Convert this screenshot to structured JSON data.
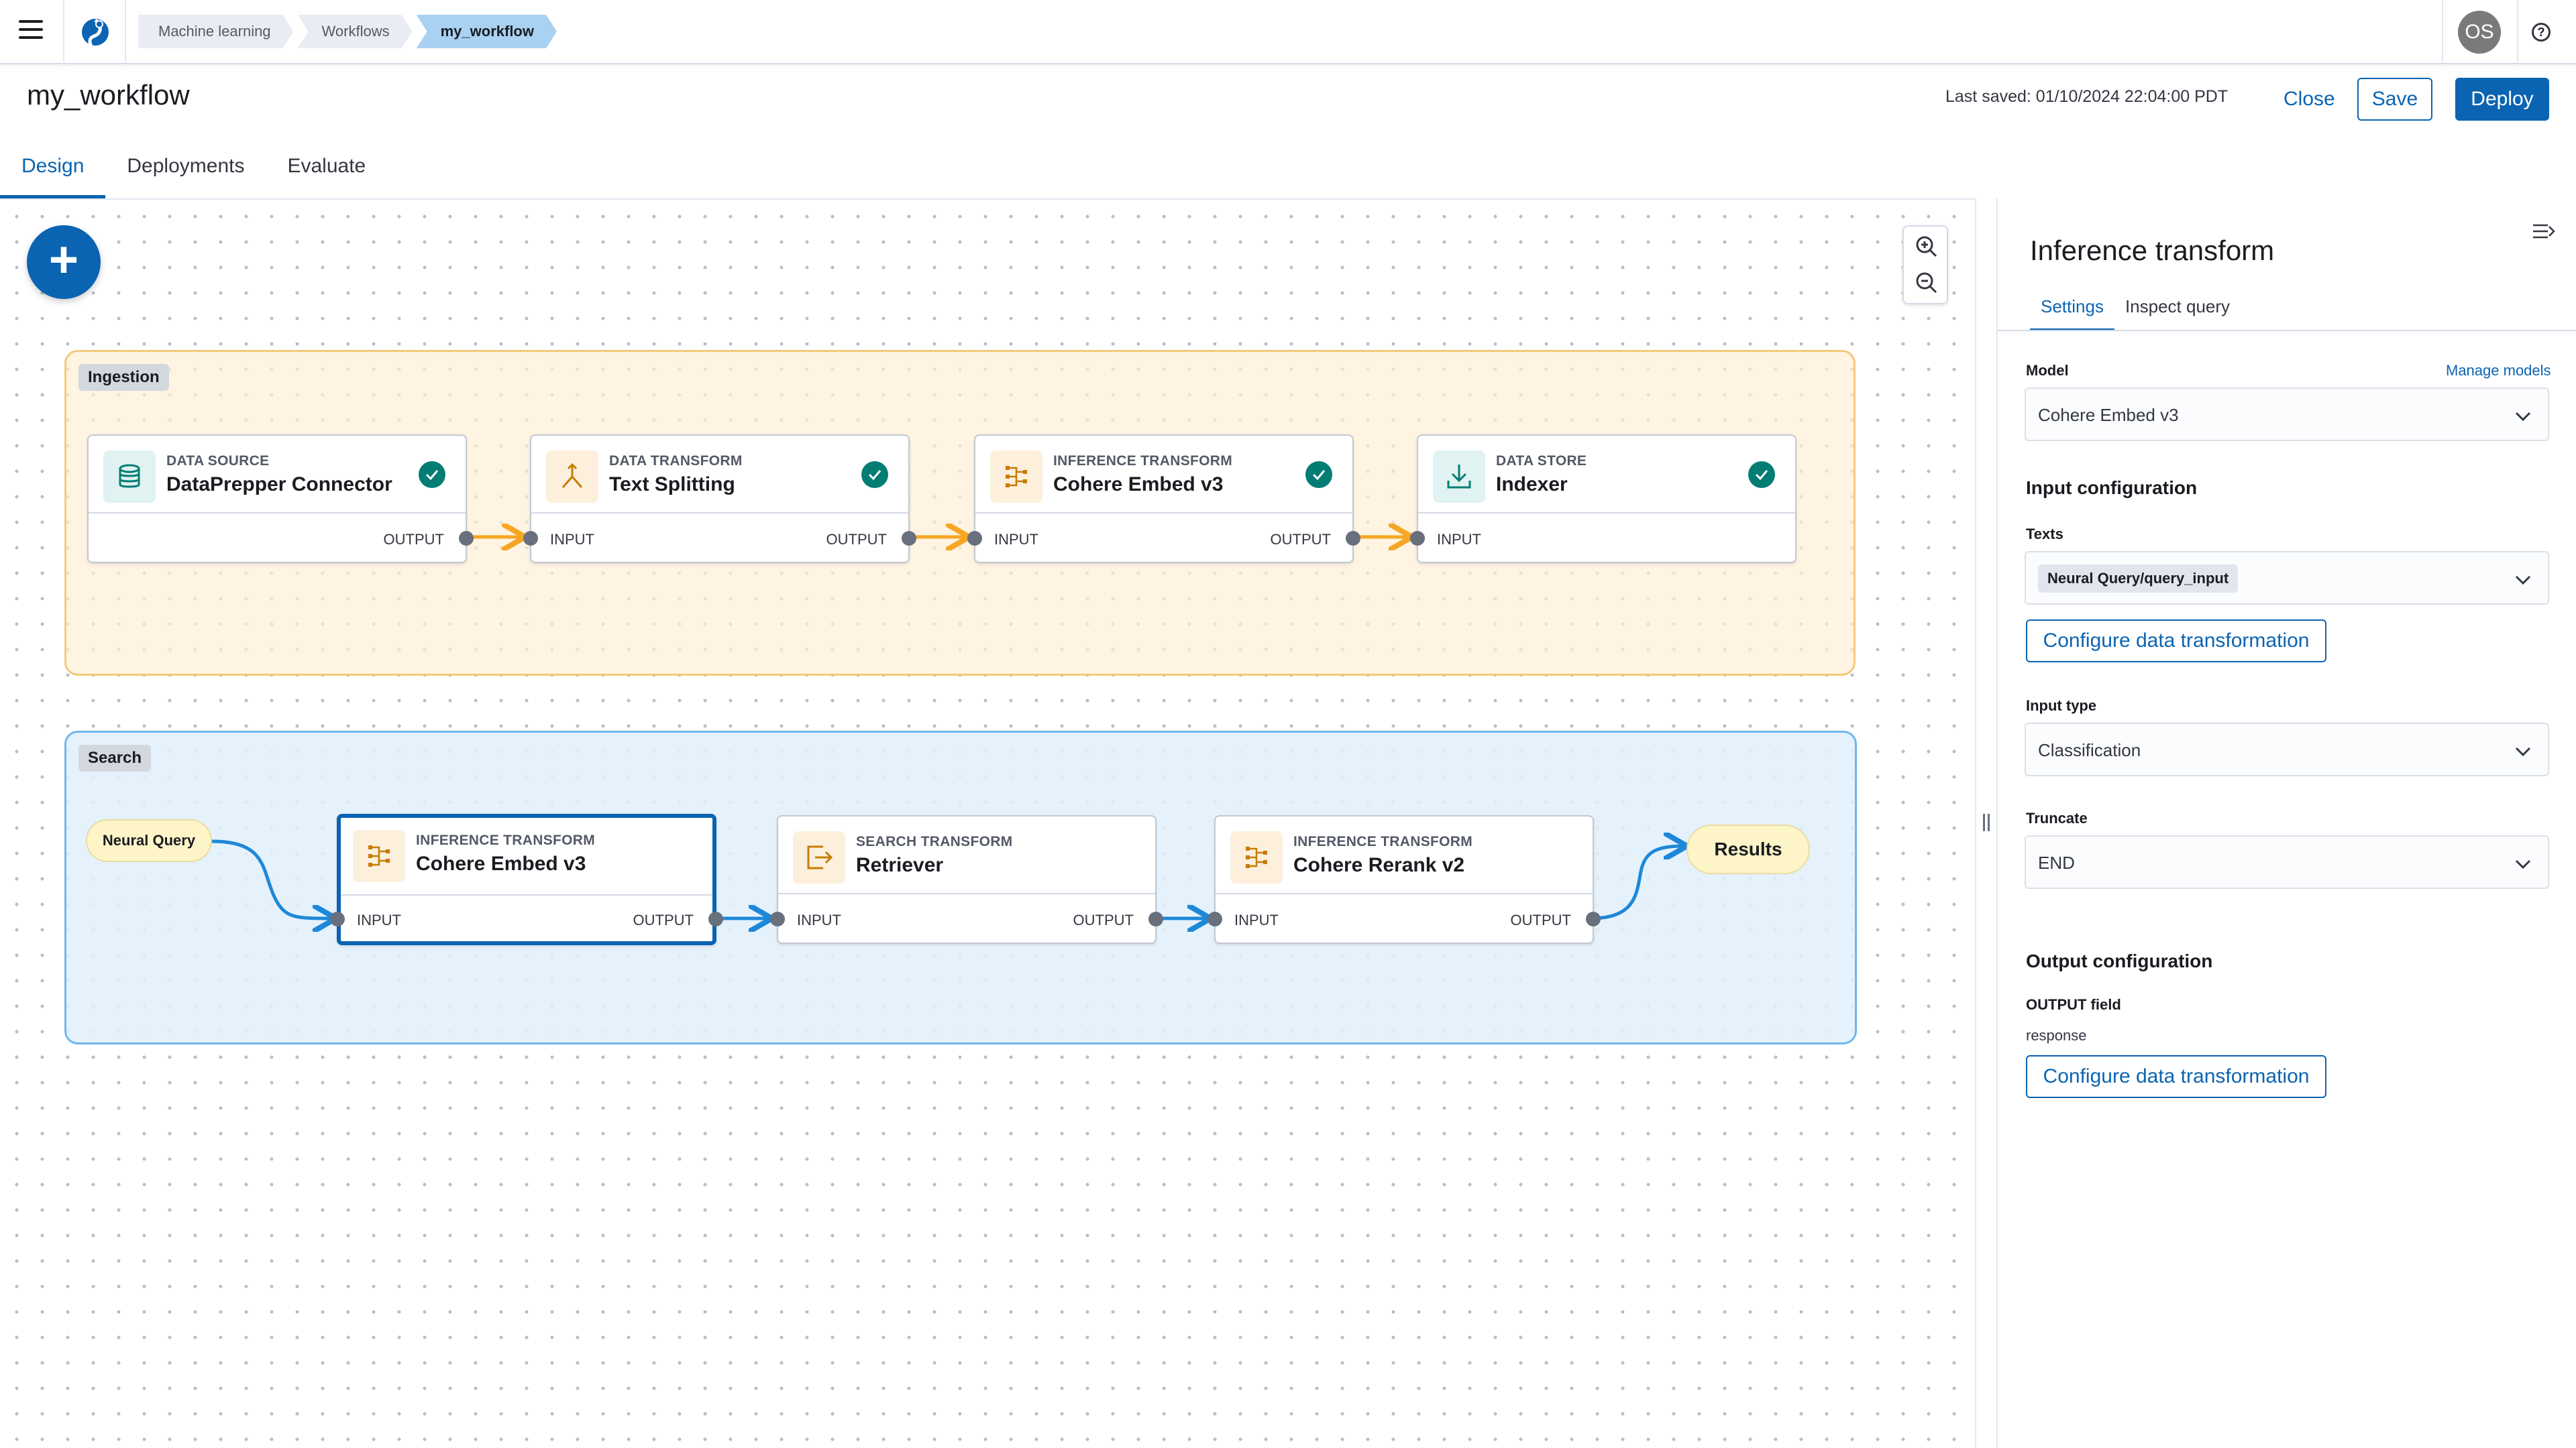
{
  "nav": {
    "breadcrumbs": [
      "Machine learning",
      "Workflows",
      "my_workflow"
    ],
    "avatar": "OS",
    "help": "?"
  },
  "header": {
    "title": "my_workflow",
    "last_saved": "Last saved: 01/10/2024 22:04:00 PDT",
    "close_label": "Close",
    "save_label": "Save",
    "deploy_label": "Deploy"
  },
  "tabs": [
    "Design",
    "Deployments",
    "Evaluate"
  ],
  "canvas": {
    "add_label": "+",
    "groups": {
      "ingestion": {
        "label": "Ingestion",
        "nodes": [
          {
            "type": "DATA SOURCE",
            "name": "DataPrepper Connector",
            "icon": "database-icon",
            "status": "complete",
            "in": "",
            "out": "OUTPUT"
          },
          {
            "type": "DATA TRANSFORM",
            "name": "Text Splitting",
            "icon": "split-icon",
            "status": "complete",
            "in": "INPUT",
            "out": "OUTPUT"
          },
          {
            "type": "INFERENCE TRANSFORM",
            "name": "Cohere Embed v3",
            "icon": "inference-icon",
            "status": "complete",
            "in": "INPUT",
            "out": "OUTPUT"
          },
          {
            "type": "DATA STORE",
            "name": "Indexer",
            "icon": "download-icon",
            "status": "complete",
            "in": "INPUT",
            "out": ""
          }
        ]
      },
      "search": {
        "label": "Search",
        "query_label": "Neural Query",
        "results_label": "Results",
        "nodes": [
          {
            "type": "INFERENCE TRANSFORM",
            "name": "Cohere Embed v3",
            "icon": "inference-icon",
            "selected": true,
            "in": "INPUT",
            "out": "OUTPUT"
          },
          {
            "type": "SEARCH TRANSFORM",
            "name": "Retriever",
            "icon": "retriever-icon",
            "in": "INPUT",
            "out": "OUTPUT"
          },
          {
            "type": "INFERENCE TRANSFORM",
            "name": "Cohere Rerank v2",
            "icon": "inference-icon",
            "in": "INPUT",
            "out": "OUTPUT"
          }
        ]
      }
    }
  },
  "panel": {
    "title": "Inference transform",
    "tabs": [
      "Settings",
      "Inspect query"
    ],
    "model_label": "Model",
    "manage_models": "Manage models",
    "model_value": "Cohere Embed v3",
    "input_config_heading": "Input configuration",
    "texts_label": "Texts",
    "texts_chip": "Neural Query/query_input",
    "configure_label": "Configure data transformation",
    "input_type_label": "Input type",
    "input_type_value": "Classification",
    "truncate_label": "Truncate",
    "truncate_value": "END",
    "output_config_heading": "Output configuration",
    "output_field_label": "OUTPUT field",
    "output_field_value": "response"
  },
  "colors": {
    "primary": "#0b64b1",
    "ingestion_edge": "#f5a623",
    "search_edge": "#1e88d8",
    "success": "#017d73"
  }
}
